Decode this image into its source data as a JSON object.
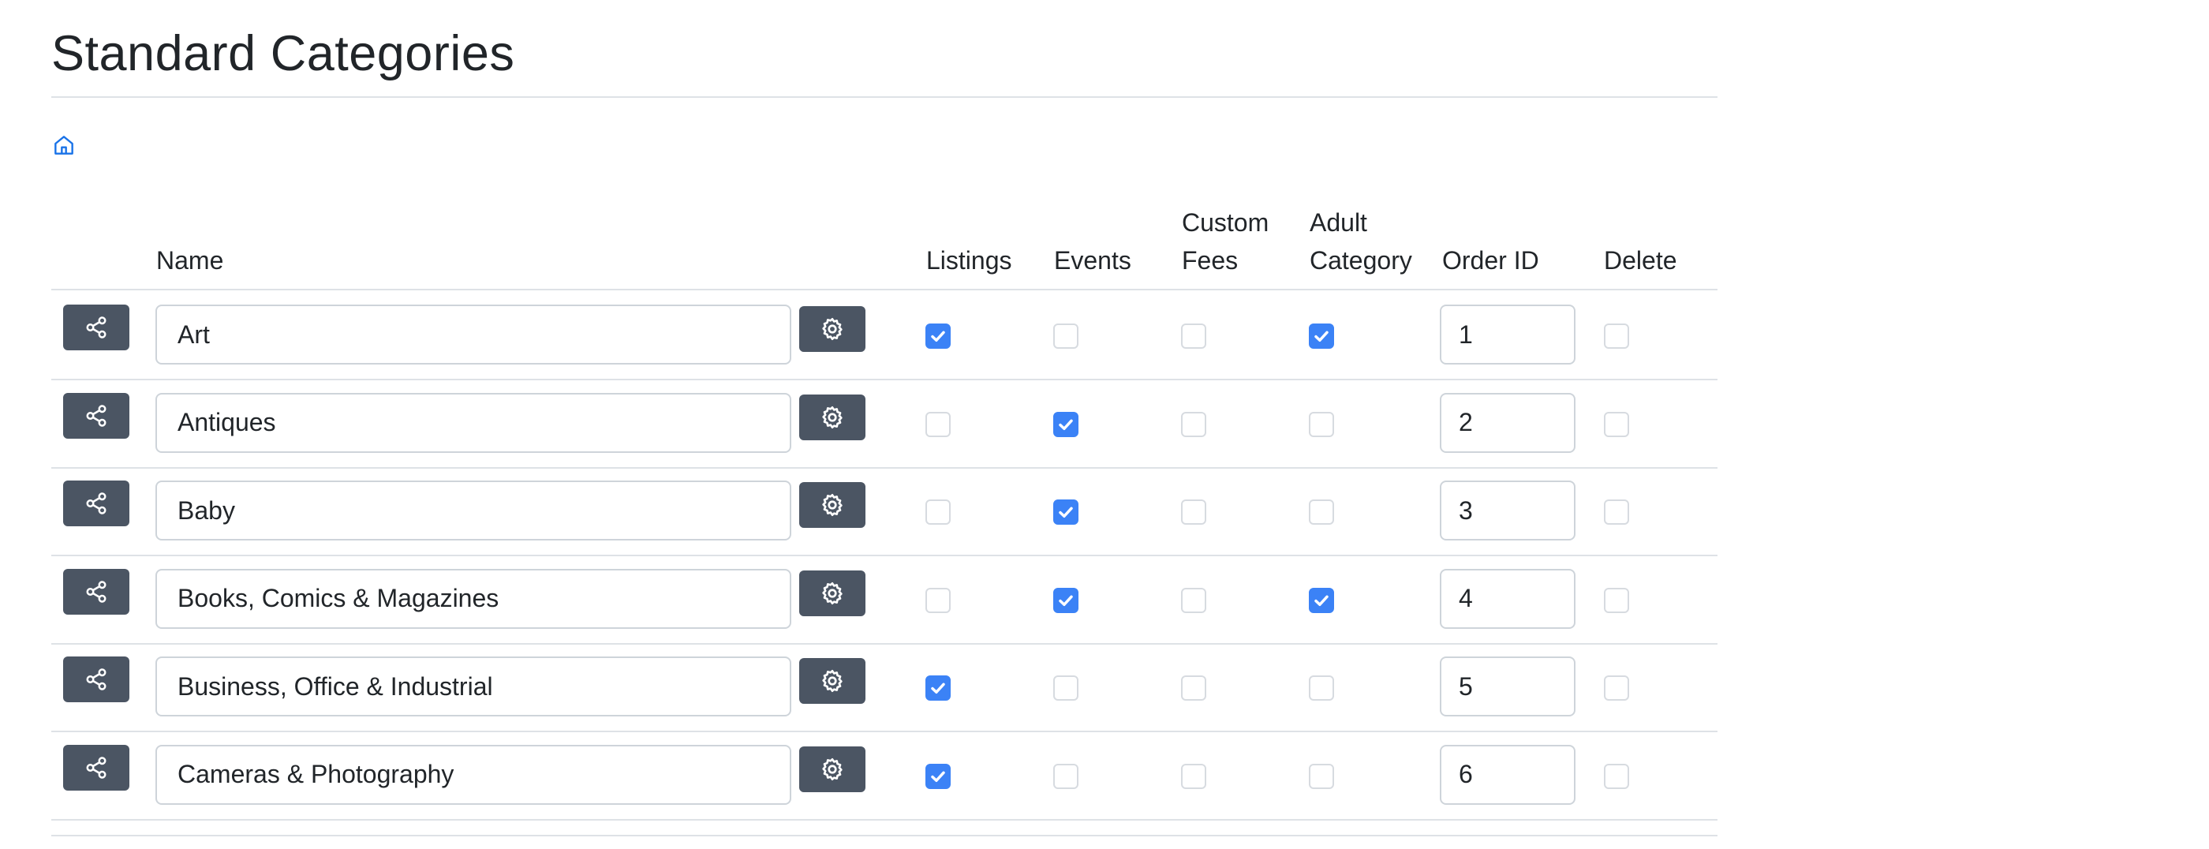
{
  "page": {
    "title": "Standard Categories"
  },
  "breadcrumb": {
    "home_icon": "home-icon"
  },
  "table": {
    "headers": {
      "name": "Name",
      "listings": "Listings",
      "events": "Events",
      "custom_fees_line1": "Custom",
      "custom_fees_line2": "Fees",
      "adult_category_line1": "Adult",
      "adult_category_line2": "Category",
      "order_id": "Order ID",
      "delete": "Delete"
    },
    "rows": [
      {
        "name": "Art",
        "listings": true,
        "events": false,
        "custom_fees": false,
        "adult_category": true,
        "order_id": "1",
        "delete": false
      },
      {
        "name": "Antiques",
        "listings": false,
        "events": true,
        "custom_fees": false,
        "adult_category": false,
        "order_id": "2",
        "delete": false
      },
      {
        "name": "Baby",
        "listings": false,
        "events": true,
        "custom_fees": false,
        "adult_category": false,
        "order_id": "3",
        "delete": false
      },
      {
        "name": "Books, Comics & Magazines",
        "listings": false,
        "events": true,
        "custom_fees": false,
        "adult_category": true,
        "order_id": "4",
        "delete": false
      },
      {
        "name": "Business, Office & Industrial",
        "listings": true,
        "events": false,
        "custom_fees": false,
        "adult_category": false,
        "order_id": "5",
        "delete": false
      },
      {
        "name": "Cameras & Photography",
        "listings": true,
        "events": false,
        "custom_fees": false,
        "adult_category": false,
        "order_id": "6",
        "delete": false
      }
    ]
  },
  "icons": {
    "share": "share-icon",
    "settings": "gear-icon",
    "check": "check-icon"
  },
  "colors": {
    "accent": "#3b82f6",
    "button_bg": "#4b5563",
    "home_link": "#1a73e8"
  }
}
